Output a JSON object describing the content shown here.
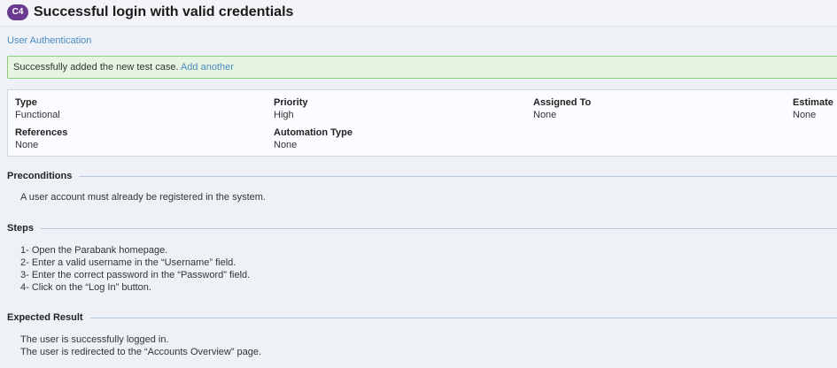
{
  "header": {
    "badge": "C4",
    "title": "Successful login with valid credentials"
  },
  "breadcrumb": {
    "section": "User Authentication"
  },
  "alert": {
    "message": "Successfully added the new test case.",
    "link": "Add another"
  },
  "details": {
    "type": {
      "label": "Type",
      "value": "Functional"
    },
    "priority": {
      "label": "Priority",
      "value": "High"
    },
    "assigned_to": {
      "label": "Assigned To",
      "value": "None"
    },
    "estimate": {
      "label": "Estimate",
      "value": "None"
    },
    "references": {
      "label": "References",
      "value": "None"
    },
    "automation_type": {
      "label": "Automation Type",
      "value": "None"
    }
  },
  "preconditions": {
    "heading": "Preconditions",
    "lines": [
      "A user account must already be registered in the system."
    ]
  },
  "steps": {
    "heading": "Steps",
    "lines": [
      "1- Open the Parabank homepage.",
      "2- Enter a valid username in the “Username” field.",
      "3- Enter the correct password in the “Password” field.",
      "4- Click on the “Log In” button."
    ]
  },
  "expected": {
    "heading": "Expected Result",
    "lines": [
      "The user is successfully logged in.",
      "The user is redirected to the “Accounts Overview” page."
    ]
  }
}
